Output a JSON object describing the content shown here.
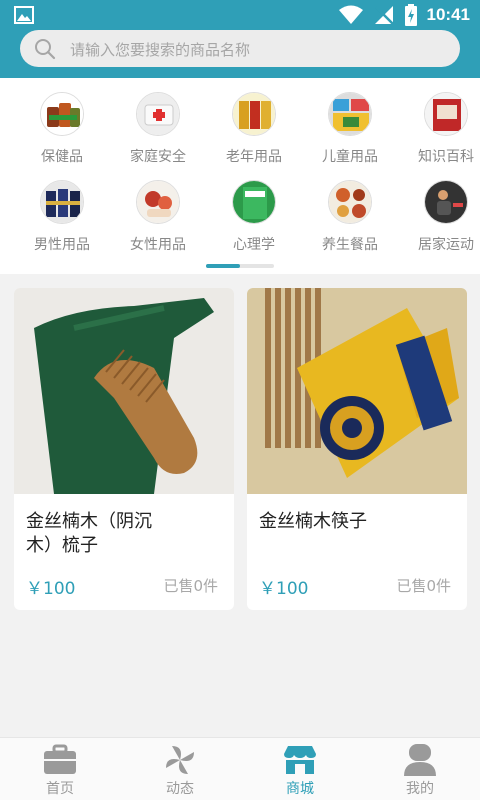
{
  "status": {
    "time": "10:41"
  },
  "search": {
    "placeholder": "请输入您要搜索的商品名称"
  },
  "categories": [
    {
      "label": "保健品",
      "icon": "health-products-icon"
    },
    {
      "label": "家庭安全",
      "icon": "home-safety-icon"
    },
    {
      "label": "老年用品",
      "icon": "elderly-products-icon"
    },
    {
      "label": "儿童用品",
      "icon": "children-products-icon"
    },
    {
      "label": "知识百科",
      "icon": "encyclopedia-icon"
    },
    {
      "label": "男性用品",
      "icon": "men-products-icon"
    },
    {
      "label": "女性用品",
      "icon": "women-products-icon"
    },
    {
      "label": "心理学",
      "icon": "psychology-icon"
    },
    {
      "label": "养生餐品",
      "icon": "health-food-icon"
    },
    {
      "label": "居家运动",
      "icon": "home-exercise-icon"
    }
  ],
  "products": [
    {
      "name": "金丝楠木（阴沉木）梳子",
      "price": "￥100",
      "sold": "已售0件"
    },
    {
      "name": "金丝楠木筷子",
      "price": "￥100",
      "sold": "已售0件"
    }
  ],
  "tabs": [
    {
      "label": "首页",
      "active": false
    },
    {
      "label": "动态",
      "active": false
    },
    {
      "label": "商城",
      "active": true
    },
    {
      "label": "我的",
      "active": false
    }
  ],
  "colors": {
    "accent": "#2f9fb7",
    "background": "#f2f2f2"
  }
}
